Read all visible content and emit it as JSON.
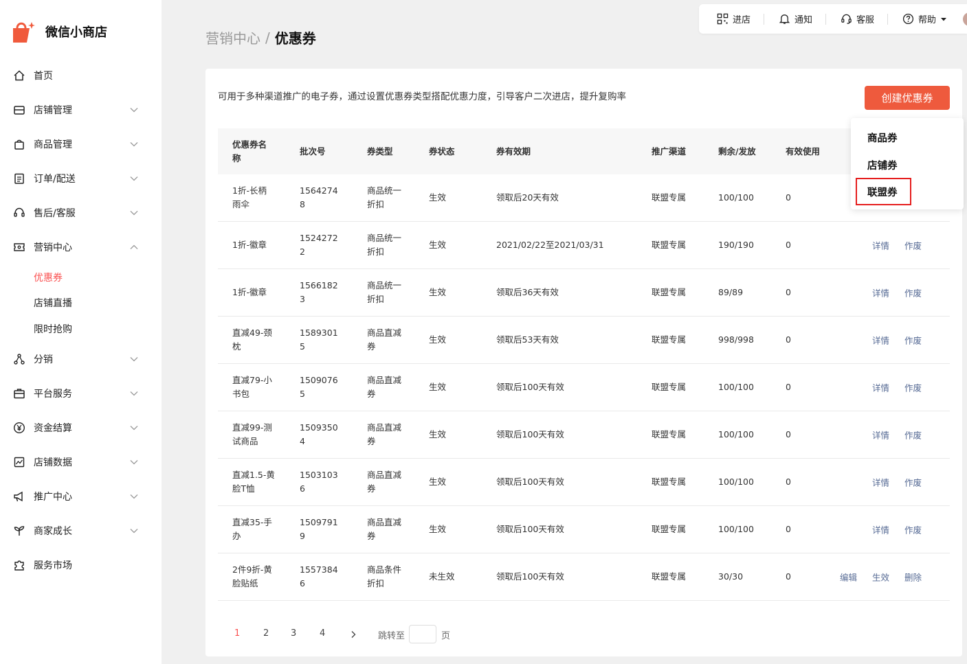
{
  "brand": {
    "name": "微信小商店",
    "color": "#f05a3c"
  },
  "nav": {
    "items": [
      {
        "label": "首页",
        "icon": "home-icon",
        "has_chevron": false
      },
      {
        "label": "店铺管理",
        "icon": "store-icon",
        "has_chevron": true
      },
      {
        "label": "商品管理",
        "icon": "bag-icon",
        "has_chevron": true
      },
      {
        "label": "订单/配送",
        "icon": "order-icon",
        "has_chevron": true
      },
      {
        "label": "售后/客服",
        "icon": "headset-icon",
        "has_chevron": true
      },
      {
        "label": "营销中心",
        "icon": "ticket-icon",
        "has_chevron": true,
        "expanded": true
      }
    ],
    "sub_items": [
      {
        "label": "优惠券",
        "active": true
      },
      {
        "label": "店铺直播",
        "active": false
      },
      {
        "label": "限时抢购",
        "active": false
      }
    ],
    "items_after": [
      {
        "label": "分销",
        "icon": "share-icon",
        "has_chevron": true
      },
      {
        "label": "平台服务",
        "icon": "briefcase-icon",
        "has_chevron": true
      },
      {
        "label": "资金结算",
        "icon": "yuan-icon",
        "has_chevron": true
      },
      {
        "label": "店铺数据",
        "icon": "chart-icon",
        "has_chevron": true
      },
      {
        "label": "推广中心",
        "icon": "megaphone-icon",
        "has_chevron": true
      },
      {
        "label": "商家成长",
        "icon": "sprout-icon",
        "has_chevron": true
      },
      {
        "label": "服务市场",
        "icon": "puzzle-icon",
        "has_chevron": false
      }
    ]
  },
  "topbar": {
    "enter_store": "进店",
    "notify": "通知",
    "service": "客服",
    "help": "帮助"
  },
  "breadcrumb": {
    "parent": "营销中心",
    "separator": "/",
    "current": "优惠券"
  },
  "card": {
    "description": "可用于多种渠道推广的电子券，通过设置优惠券类型搭配优惠力度，引导客户二次进店，提升复购率",
    "create_button": "创建优惠券",
    "accent_color": "#ee5a3d"
  },
  "dropdown": {
    "options": [
      "商品券",
      "店铺券",
      "联盟券"
    ],
    "highlighted": "联盟券"
  },
  "table": {
    "headers": [
      "优惠券名称",
      "批次号",
      "券类型",
      "券状态",
      "券有效期",
      "推广渠道",
      "剩余/发放",
      "有效使用"
    ],
    "rows": [
      {
        "name": "1折-长柄雨伞",
        "batch": "15642748",
        "type": "商品统一折扣",
        "status": "生效",
        "validity": "领取后20天有效",
        "channel": "联盟专属",
        "remain": "100/100",
        "used": "0",
        "actions": []
      },
      {
        "name": "1折-徽章",
        "batch": "15242722",
        "type": "商品统一折扣",
        "status": "生效",
        "validity": "2021/02/22至2021/03/31",
        "channel": "联盟专属",
        "remain": "190/190",
        "used": "0",
        "actions": [
          "详情",
          "作废"
        ]
      },
      {
        "name": "1折-徽章",
        "batch": "15661823",
        "type": "商品统一折扣",
        "status": "生效",
        "validity": "领取后36天有效",
        "channel": "联盟专属",
        "remain": "89/89",
        "used": "0",
        "actions": [
          "详情",
          "作废"
        ]
      },
      {
        "name": "直减49-颈枕",
        "batch": "15893015",
        "type": "商品直减券",
        "status": "生效",
        "validity": "领取后53天有效",
        "channel": "联盟专属",
        "remain": "998/998",
        "used": "0",
        "actions": [
          "详情",
          "作废"
        ]
      },
      {
        "name": "直减79-小书包",
        "batch": "15090765",
        "type": "商品直减券",
        "status": "生效",
        "validity": "领取后100天有效",
        "channel": "联盟专属",
        "remain": "100/100",
        "used": "0",
        "actions": [
          "详情",
          "作废"
        ]
      },
      {
        "name": "直减99-测试商品",
        "batch": "15093504",
        "type": "商品直减券",
        "status": "生效",
        "validity": "领取后100天有效",
        "channel": "联盟专属",
        "remain": "100/100",
        "used": "0",
        "actions": [
          "详情",
          "作废"
        ]
      },
      {
        "name": "直减1.5-黄脸T恤",
        "batch": "15031036",
        "type": "商品直减券",
        "status": "生效",
        "validity": "领取后100天有效",
        "channel": "联盟专属",
        "remain": "100/100",
        "used": "0",
        "actions": [
          "详情",
          "作废"
        ]
      },
      {
        "name": "直减35-手办",
        "batch": "15097919",
        "type": "商品直减券",
        "status": "生效",
        "validity": "领取后100天有效",
        "channel": "联盟专属",
        "remain": "100/100",
        "used": "0",
        "actions": [
          "详情",
          "作废"
        ]
      },
      {
        "name": "2件9折-黄脸贴纸",
        "batch": "15573846",
        "type": "商品条件折扣",
        "status": "未生效",
        "validity": "领取后100天有效",
        "channel": "联盟专属",
        "remain": "30/30",
        "used": "0",
        "actions": [
          "编辑",
          "生效",
          "删除"
        ]
      }
    ]
  },
  "pagination": {
    "pages": [
      "1",
      "2",
      "3",
      "4"
    ],
    "current": "1",
    "jump_label": "跳转至",
    "jump_value": "",
    "jump_unit": "页"
  }
}
